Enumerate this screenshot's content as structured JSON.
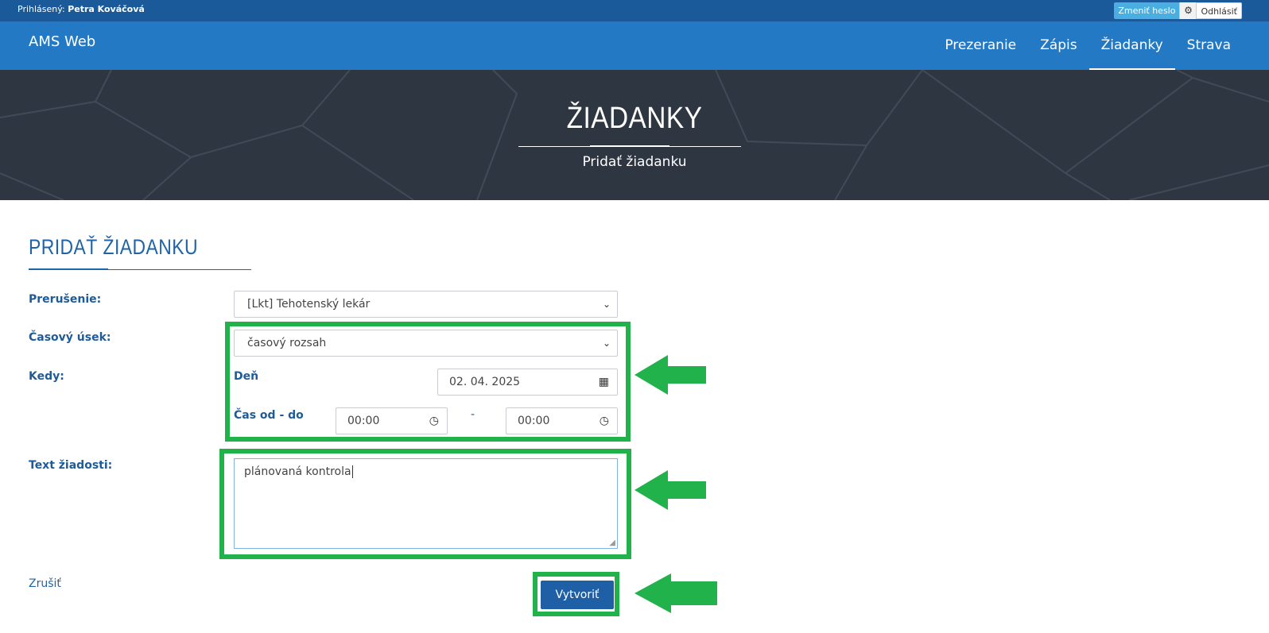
{
  "topbar": {
    "logged_in_label": "Prihlásený:",
    "user_name": "Petra Kováčová",
    "change_password": "Zmeniť heslo",
    "logout": "Odhlásiť"
  },
  "navbar": {
    "brand": "AMS Web",
    "items": [
      {
        "label": "Prezeranie"
      },
      {
        "label": "Zápis"
      },
      {
        "label": "Žiadanky"
      },
      {
        "label": "Strava"
      }
    ],
    "active_item": "Žiadanky"
  },
  "banner": {
    "title": "ŽIADANKY",
    "subtitle": "Pridať žiadanku"
  },
  "form": {
    "section_title": "PRIDAŤ ŽIADANKU",
    "interruption_label": "Prerušenie:",
    "interruption_value": "[Lkt] Tehotenský lekár",
    "timespan_label": "Časový úsek:",
    "timespan_value": "časový rozsah",
    "when_label": "Kedy:",
    "day_label": "Deň",
    "day_value": "02. 04. 2025",
    "time_label": "Čas od - do",
    "time_from": "00:00",
    "time_separator": "-",
    "time_to": "00:00",
    "request_text_label": "Text žiadosti:",
    "request_text_value": "plánovaná kontrola",
    "cancel": "Zrušiť",
    "submit": "Vytvoriť"
  },
  "colors": {
    "topbar": "#1a5a9a",
    "navbar": "#2479c5",
    "banner": "#2e3642",
    "label_blue": "#1f5a99",
    "button_blue": "#1f5fa6",
    "highlight_green": "#22b24c"
  }
}
